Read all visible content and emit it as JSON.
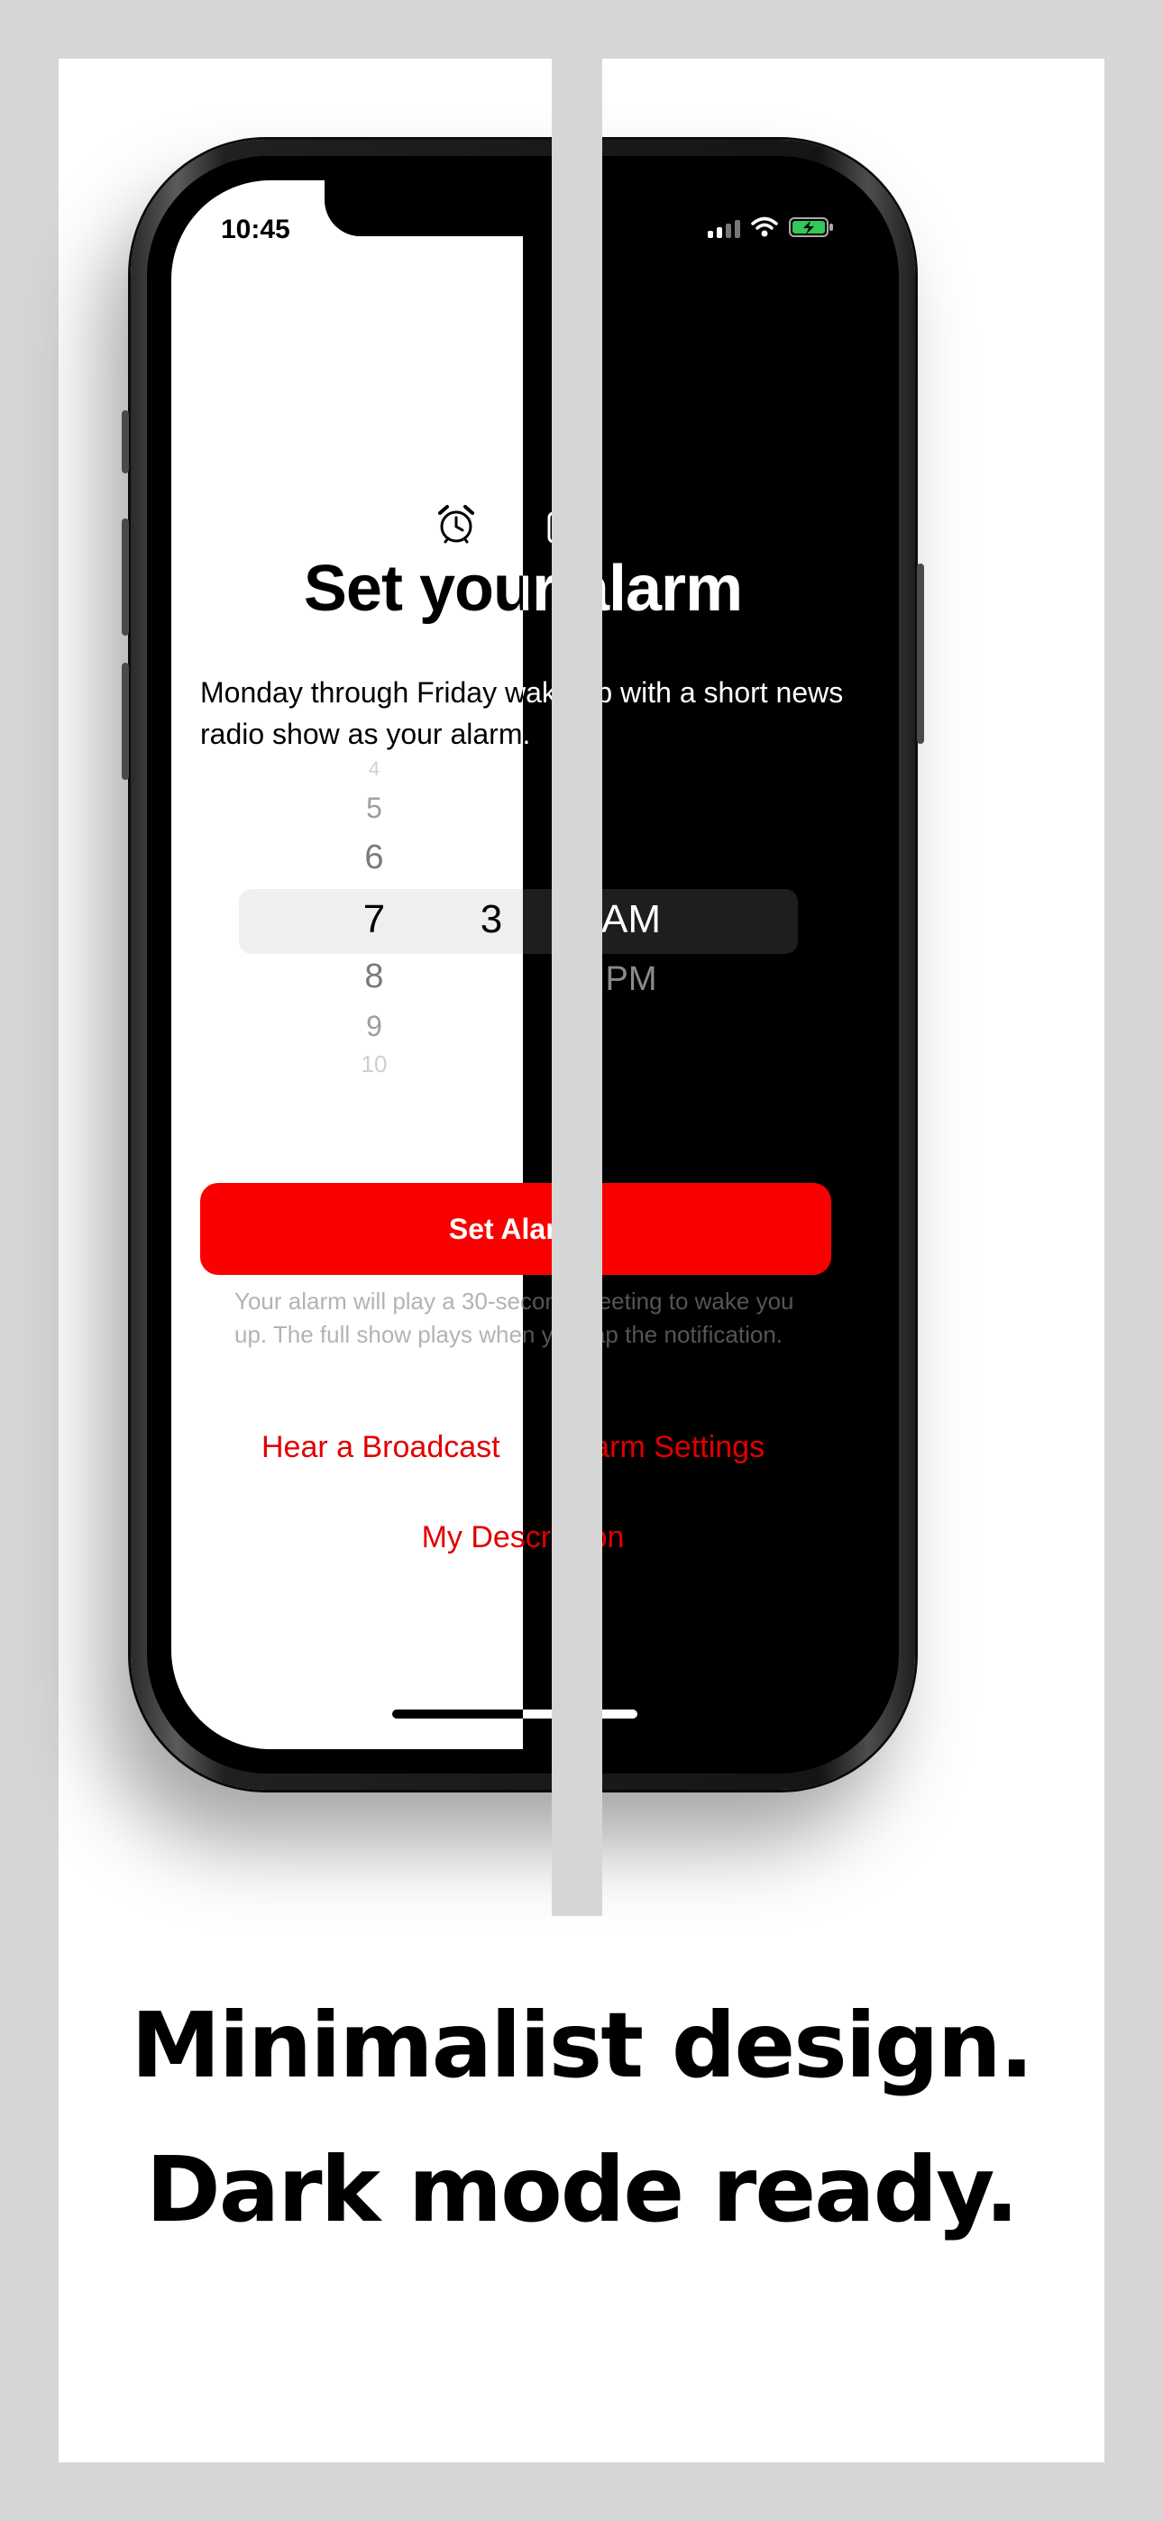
{
  "status_bar": {
    "time": "10:45"
  },
  "screen": {
    "title": "Set your alarm",
    "description": "Monday through Friday wake up with a short news radio show as your alarm.",
    "picker": {
      "hours": [
        "4",
        "5",
        "6",
        "7",
        "8",
        "9",
        "10"
      ],
      "minutes": [
        "",
        "",
        "",
        "3",
        "",
        "",
        ""
      ],
      "periods": [
        "AM",
        "PM"
      ],
      "selected_hour": "7",
      "selected_period": "AM"
    },
    "set_button_label": "Set Alarm",
    "note": "Your alarm will play a 30-second greeting to wake you up. The full show plays when you tap the notification.",
    "links": {
      "hear_broadcast": "Hear a Broadcast",
      "alarm_settings": "Alarm Settings",
      "my_description": "My Description"
    }
  },
  "headline": {
    "line1": "Minimalist design.",
    "line2": "Dark mode ready."
  },
  "colors": {
    "accent": "#fa0000",
    "link": "#e10000",
    "background": "#d6d6d6"
  },
  "icons": [
    "alarm-clock-icon",
    "radio-icon",
    "signal-icon",
    "wifi-icon",
    "battery-icon"
  ]
}
